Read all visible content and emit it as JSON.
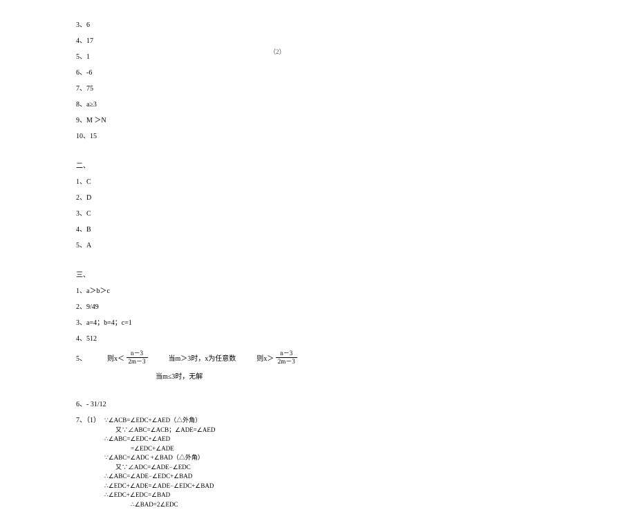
{
  "aside_marker": "（2）",
  "section1": {
    "items": [
      "3、6",
      "4、17",
      "5、1",
      "6、-6",
      "7、75",
      "8、a≥3",
      "9、M ＞N",
      "10、15"
    ]
  },
  "section2": {
    "header": "二、",
    "items": [
      "1、C",
      "2、D",
      "3、C",
      "4、B",
      "5、A"
    ]
  },
  "section3": {
    "header": "三、",
    "items": [
      "1、a＞b＞c",
      "2、9/49",
      "3、a=4；b=4；c=1",
      "4、512"
    ],
    "q5": {
      "label": "5、",
      "left_prefix": "则x＜",
      "frac_num": "n－3",
      "frac_den": "2m－3",
      "mid_text": "当m＞3时，x为任意数",
      "right_prefix": "则x＞",
      "sub_text": "当m≤3时，无解"
    },
    "q6": "6、- 31/12",
    "q7": {
      "label": "7、（1）",
      "lines": [
        {
          "cls": "",
          "t": "∵∠ACB=∠EDC+∠AED（△外角）"
        },
        {
          "cls": "indent1",
          "t": "又∵∠ABC=∠ACB；∠ADE=∠AED"
        },
        {
          "cls": "",
          "t": "∴∠ABC=∠EDC+∠AED"
        },
        {
          "cls": "indent2",
          "t": "=∠EDC+∠ADE"
        },
        {
          "cls": "",
          "t": "∵∠ABC=∠ADC +∠BAD（△外角）"
        },
        {
          "cls": "indent1",
          "t": "又∵∠ADC=∠ADE−∠EDC"
        },
        {
          "cls": "",
          "t": "∴∠ABC=∠ADE−∠EDC+∠BAD"
        },
        {
          "cls": "",
          "t": "∴∠EDC+∠ADE=∠ADE−∠EDC+∠BAD"
        },
        {
          "cls": "",
          "t": "∴∠EDC+∠EDC=∠BAD"
        },
        {
          "cls": "indent2",
          "t": "∴∠BAD=2∠EDC"
        }
      ]
    }
  }
}
